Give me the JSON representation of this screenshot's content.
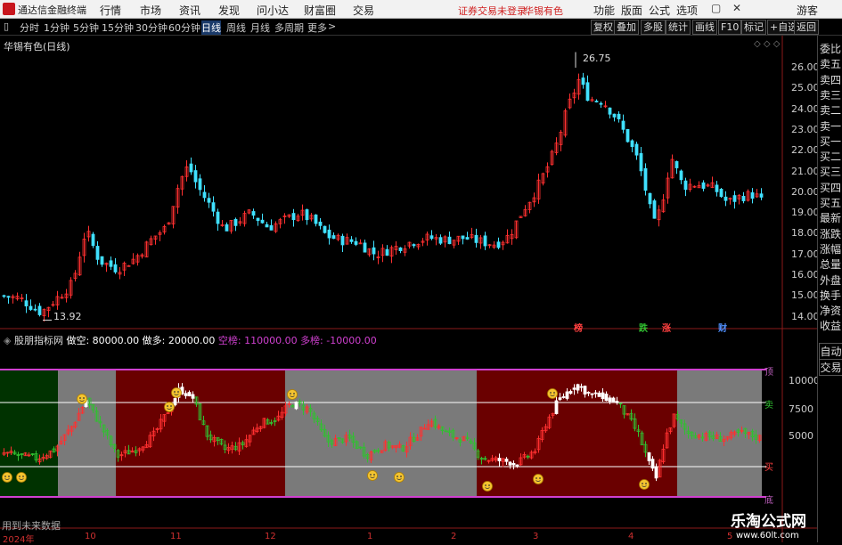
{
  "titlebar": {
    "app_title": "通达信金融终端",
    "menu": [
      "行情",
      "市场",
      "资讯",
      "发现",
      "问小达",
      "财富圈",
      "交易"
    ],
    "login_status": "证券交易未登录",
    "stock_name": "华锡有色",
    "right_menu": [
      "功能",
      "版面",
      "公式",
      "选项"
    ],
    "guest": "游客"
  },
  "toolbar": {
    "periods": [
      "分时",
      "1分钟",
      "5分钟",
      "15分钟",
      "30分钟",
      "60分钟",
      "日线",
      "周线",
      "月线",
      "多周期",
      "更多"
    ],
    "active_period": "日线",
    "right_buttons": [
      "复权",
      "叠加",
      "多股",
      "统计",
      "画线",
      "F10",
      "标记",
      "+自选",
      "返回"
    ]
  },
  "main_chart": {
    "title": "华锡有色(日线)",
    "price_ticks": [
      "26.00",
      "25.00",
      "24.00",
      "23.00",
      "22.00",
      "21.00",
      "20.00",
      "19.00",
      "18.00",
      "17.00",
      "16.00",
      "15.00",
      "14.00"
    ],
    "high_label": "26.75",
    "low_label": "13.92",
    "event_tags": [
      {
        "text": "榜",
        "color": "#ff4040"
      },
      {
        "text": "跌",
        "color": "#30c030"
      },
      {
        "text": "涨",
        "color": "#ff4040"
      },
      {
        "text": "财",
        "color": "#5090ff"
      }
    ]
  },
  "indicator": {
    "name": "股朋指标网",
    "legend": [
      {
        "label": "做空: 80000.00",
        "color": "#ffffff"
      },
      {
        "label": "做多: 20000.00",
        "color": "#ffffff"
      },
      {
        "label": "空榜: 110000.00",
        "color": "#d040d0"
      },
      {
        "label": "多榜: -10000.00",
        "color": "#d040d0"
      }
    ],
    "ticks": [
      "10000",
      "7500",
      "5000"
    ],
    "side_labels": [
      "顶",
      "卖",
      "买",
      "底"
    ]
  },
  "right_panel": {
    "items": [
      "委比",
      "卖五",
      "卖四",
      "卖三",
      "卖二",
      "卖一",
      "买一",
      "买二",
      "买三",
      "买四",
      "买五",
      "最新",
      "涨跌",
      "涨幅",
      "总量",
      "外盘",
      "换手",
      "净资",
      "收益"
    ],
    "bottom_buttons": [
      "自动",
      "交易"
    ]
  },
  "footer": {
    "note": "用到未来数据",
    "time_labels": [
      "2024年",
      "10",
      "11",
      "12",
      "1",
      "2",
      "3",
      "4",
      "5"
    ],
    "watermark_title": "乐淘公式网",
    "watermark_url": "www.60lt.com"
  },
  "colors": {
    "up": "#ff3030",
    "down": "#40e0ff",
    "ind_up": "#ff3030",
    "ind_down": "#30c030",
    "bg": "#000000"
  }
}
